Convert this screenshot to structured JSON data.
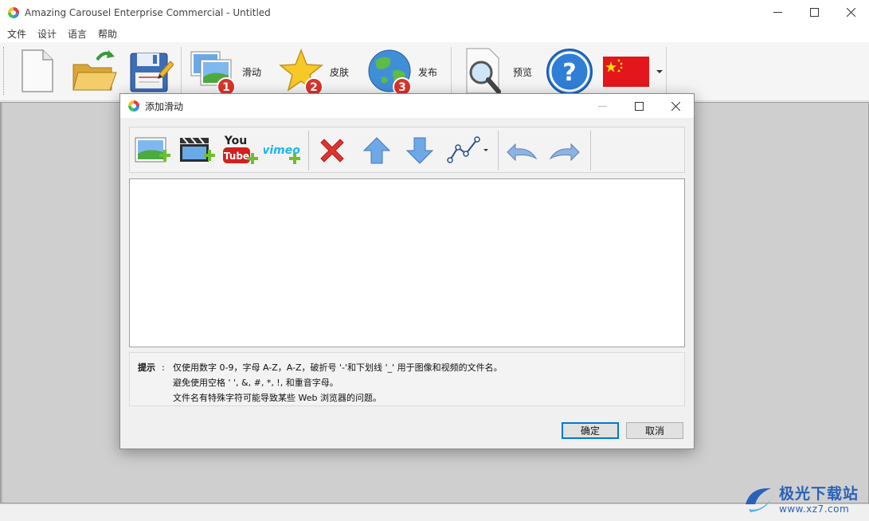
{
  "app": {
    "title": "Amazing Carousel Enterprise Commercial - Untitled"
  },
  "menu": [
    "文件",
    "设计",
    "语言",
    "帮助"
  ],
  "toolbar": {
    "slides_label": "滑动",
    "skins_label": "皮肤",
    "publish_label": "发布",
    "preview_label": "预览",
    "step_badges": [
      "1",
      "2",
      "3"
    ]
  },
  "dialog": {
    "title": "添加滑动",
    "youtube_top": "You",
    "youtube_bottom": "Tube",
    "vimeo_label": "vimeo",
    "hint_label": "提示",
    "hint_colon": ":",
    "hint_line1": "仅使用数字 0-9，字母 A-Z，A-Z，破折号 '-'和下划线 '_' 用于图像和视频的文件名。",
    "hint_line2": "避免使用空格 ' ', &, #, *, !, 和重音字母。",
    "hint_line3": "文件名有特殊字符可能导致某些 Web 浏览器的问题。",
    "ok_label": "确定",
    "cancel_label": "取消"
  },
  "watermark": {
    "brand": "极光下载站",
    "url": "www.xz7.com"
  },
  "colors": {
    "accent": "#0078d7",
    "badge_red": "#d9352b",
    "flag_red": "#e3161b",
    "flag_yellow": "#ffde00"
  }
}
